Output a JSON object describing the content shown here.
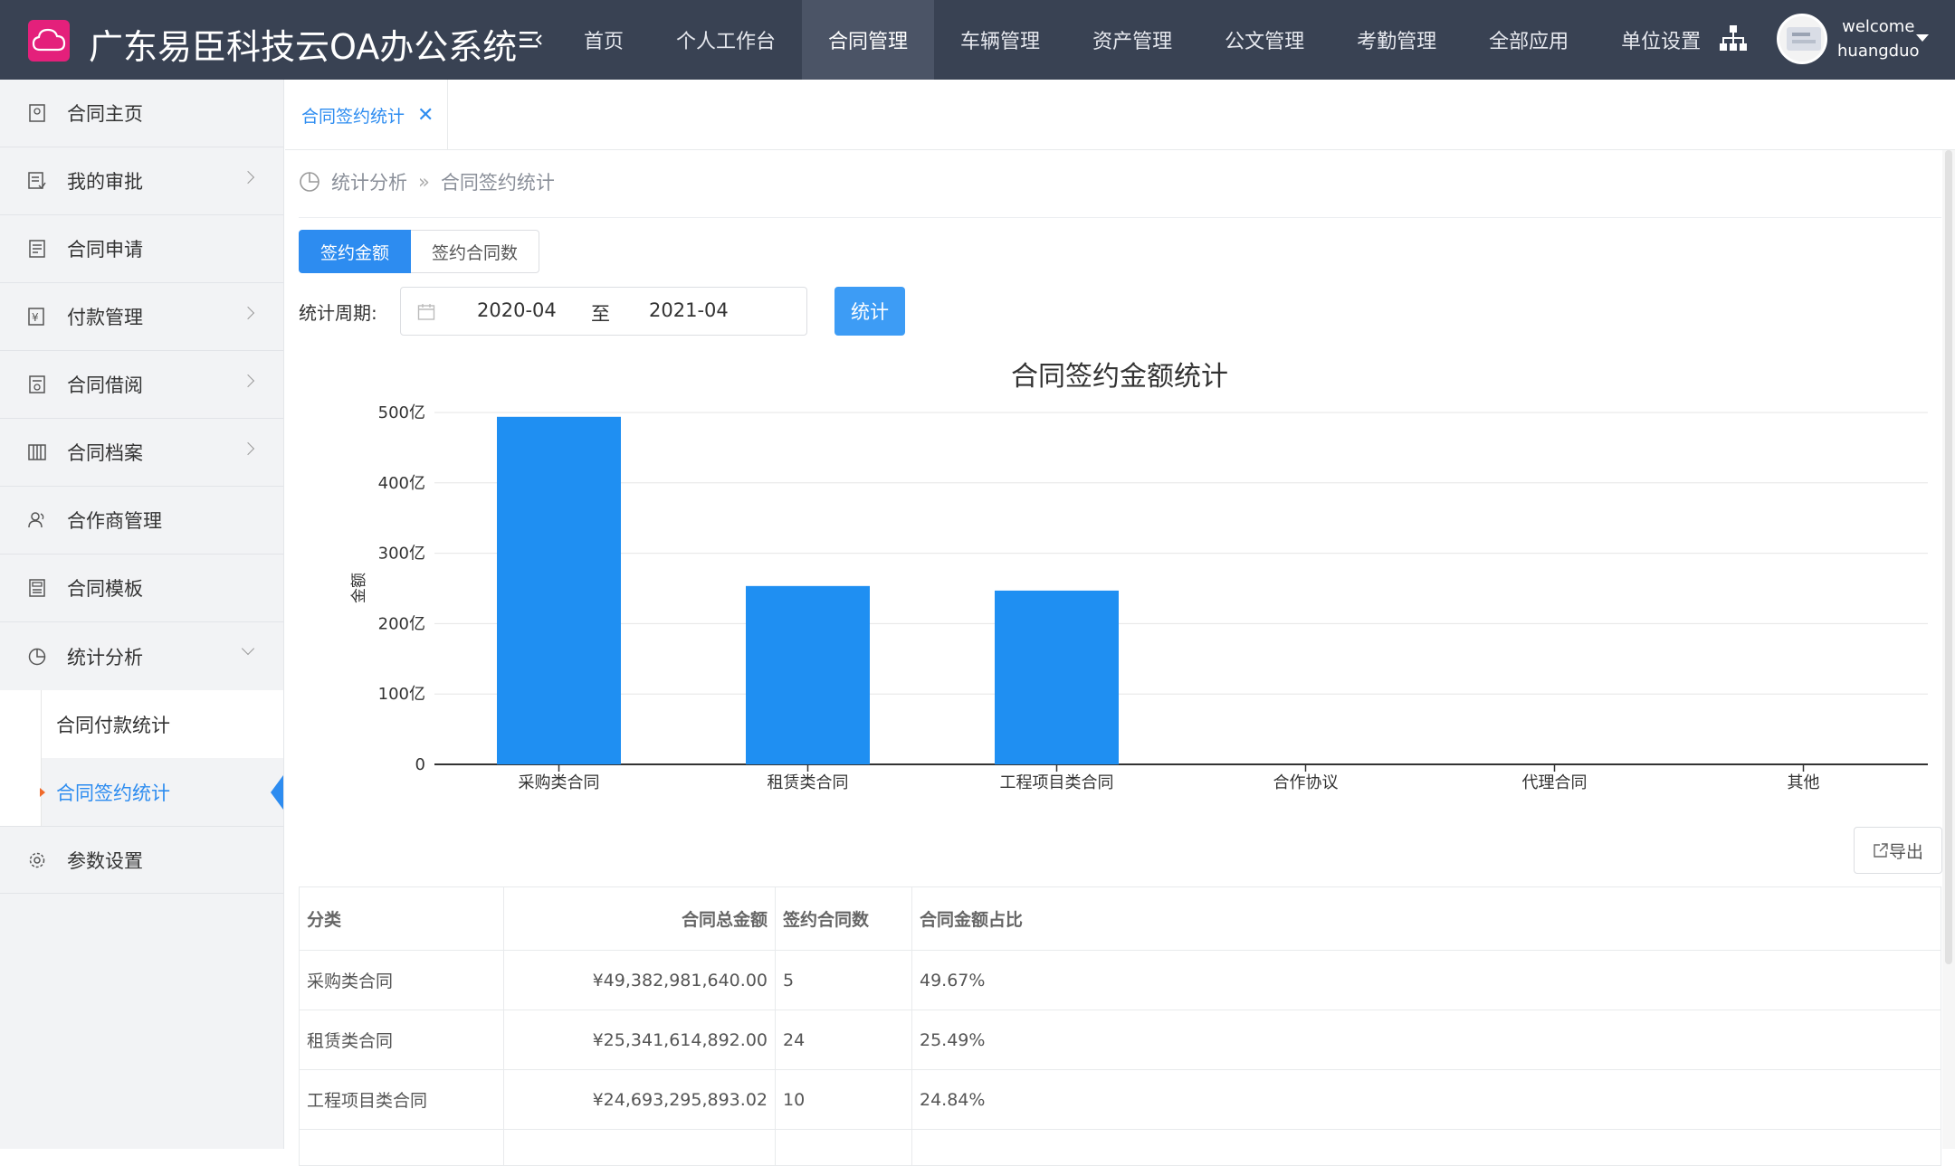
{
  "header": {
    "app_title": "广东易臣科技云OA办公系统",
    "nav": [
      "首页",
      "个人工作台",
      "合同管理",
      "车辆管理",
      "资产管理",
      "公文管理",
      "考勤管理",
      "全部应用",
      "单位设置"
    ],
    "active_nav": "合同管理",
    "welcome": "welcome",
    "username": "huangduo"
  },
  "sidebar": {
    "items": [
      {
        "label": "合同主页",
        "icon": "contract-home-icon",
        "has_children": false
      },
      {
        "label": "我的审批",
        "icon": "approval-icon",
        "has_children": true
      },
      {
        "label": "合同申请",
        "icon": "application-icon",
        "has_children": false
      },
      {
        "label": "付款管理",
        "icon": "payment-icon",
        "has_children": true
      },
      {
        "label": "合同借阅",
        "icon": "borrow-icon",
        "has_children": true
      },
      {
        "label": "合同档案",
        "icon": "archive-icon",
        "has_children": true
      },
      {
        "label": "合作商管理",
        "icon": "partner-icon",
        "has_children": false
      },
      {
        "label": "合同模板",
        "icon": "template-icon",
        "has_children": false
      },
      {
        "label": "统计分析",
        "icon": "pie-chart-icon",
        "has_children": true,
        "expanded": true
      }
    ],
    "sub_items": [
      "合同付款统计",
      "合同签约统计"
    ],
    "active_sub": "合同签约统计",
    "last_item": "参数设置"
  },
  "tab": {
    "label": "合同签约统计",
    "close": "✕"
  },
  "breadcrumb": {
    "parent": "统计分析",
    "sep": "»",
    "current": "合同签约统计"
  },
  "segments": [
    "签约金额",
    "签约合同数"
  ],
  "active_segment": "签约金额",
  "period": {
    "label": "统计周期:",
    "start": "2020-04",
    "to": "至",
    "end": "2021-04"
  },
  "stat_button": "统计",
  "export_button": "导出",
  "colors": {
    "primary": "#2d8cf0",
    "bar": "#1f8ff2",
    "topbar": "#394253"
  },
  "chart_data": {
    "type": "bar",
    "title": "合同签约金额统计",
    "ylabel": "金额",
    "categories": [
      "采购类合同",
      "租赁类合同",
      "工程项目类合同",
      "合作协议",
      "代理合同",
      "其他"
    ],
    "values": [
      493.83,
      253.42,
      246.93,
      0,
      0,
      0
    ],
    "ylim": [
      0,
      500
    ],
    "yticks": [
      "0",
      "100亿",
      "200亿",
      "300亿",
      "400亿",
      "500亿"
    ],
    "grid": true
  },
  "table": {
    "headers": [
      "分类",
      "合同总金额",
      "签约合同数",
      "合同金额占比"
    ],
    "rows": [
      [
        "采购类合同",
        "¥49,382,981,640.00",
        "5",
        "49.67%"
      ],
      [
        "租赁类合同",
        "¥25,341,614,892.00",
        "24",
        "25.49%"
      ],
      [
        "工程项目类合同",
        "¥24,693,295,893.02",
        "10",
        "24.84%"
      ]
    ]
  }
}
